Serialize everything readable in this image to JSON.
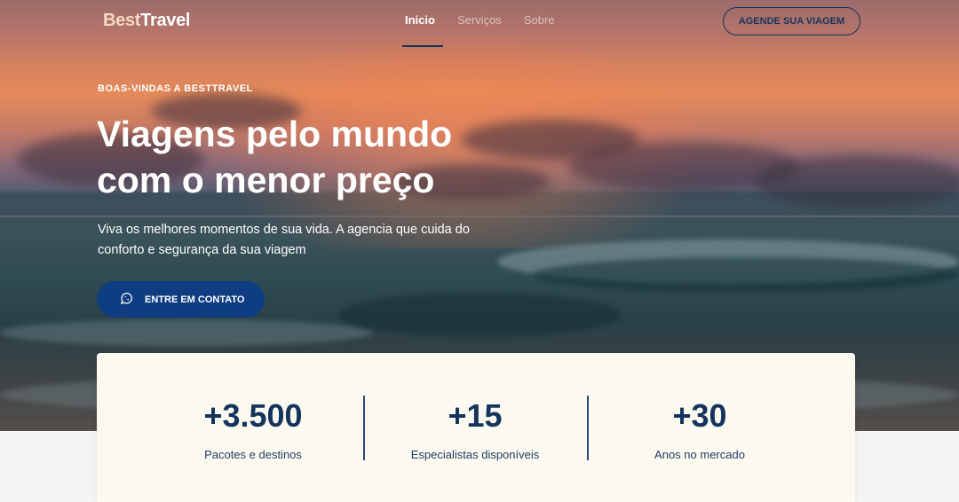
{
  "header": {
    "logo_part1": "Best",
    "logo_part2": "Travel",
    "nav": [
      "Inicio",
      "Serviços",
      "Sobre"
    ],
    "cta_label": "AGENDE SUA VIAGEM"
  },
  "hero": {
    "eyebrow": "BOAS-VINDAS A BESTTRAVEL",
    "headline": "Viagens pelo mundo com o menor preço",
    "subtext": "Viva os melhores momentos de sua vida. A agencia que cuida do conforto e segurança da sua viagem",
    "cta_icon": "whatsapp-icon",
    "cta_label": "ENTRE EM CONTATO"
  },
  "stats": [
    {
      "value": "+3.500",
      "label": "Pacotes e destinos"
    },
    {
      "value": "+15",
      "label": "Especialistas disponíveis"
    },
    {
      "value": "+30",
      "label": "Anos no mercado"
    }
  ],
  "colors": {
    "brand": "#14345d",
    "cta": "#0f3d82",
    "stats_bg": "#fcfaf0"
  }
}
